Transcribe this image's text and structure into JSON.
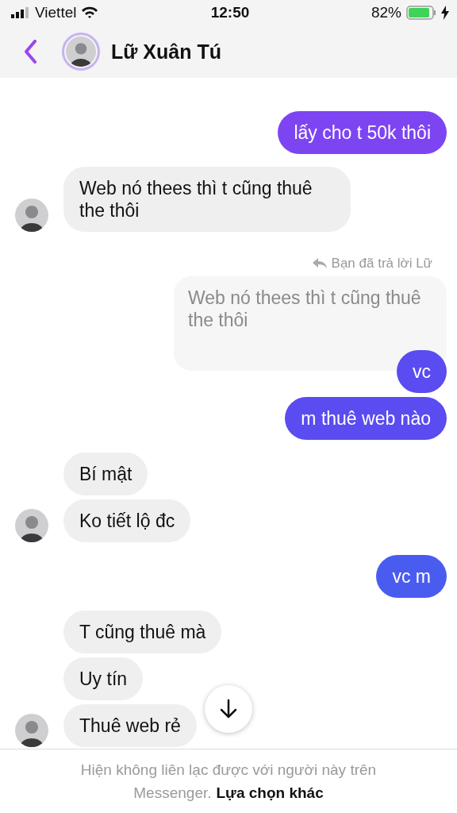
{
  "status_bar": {
    "carrier": "Viettel",
    "time": "12:50",
    "battery": "82%"
  },
  "header": {
    "name": "Lữ Xuân Tú"
  },
  "messages": [
    {
      "kind": "outgoing",
      "text": "lấy cho t 50k thôi"
    },
    {
      "kind": "incoming",
      "text": "Web nó thees thì t cũng thuê the thôi",
      "avatar": true
    },
    {
      "kind": "reply_note",
      "text": "Bạn đã trả lời Lữ"
    },
    {
      "kind": "quoted",
      "text": "Web nó thees thì t cũng thuê the thôi"
    },
    {
      "kind": "outgoing",
      "text": "vc"
    },
    {
      "kind": "outgoing",
      "text": "m thuê web nào"
    },
    {
      "kind": "incoming",
      "text": "Bí mật",
      "avatar": false
    },
    {
      "kind": "incoming",
      "text": "Ko tiết lộ đc",
      "avatar": true
    },
    {
      "kind": "outgoing",
      "text": "vc m"
    },
    {
      "kind": "incoming",
      "text": "T cũng thuê mà",
      "avatar": false
    },
    {
      "kind": "incoming",
      "text": "Uy tín",
      "avatar": false
    },
    {
      "kind": "incoming",
      "text": "Thuê web rẻ",
      "avatar": true
    }
  ],
  "footer": {
    "notice": "Hiện không liên lạc được với người này trên Messenger.",
    "link": "Lựa chọn khác"
  }
}
